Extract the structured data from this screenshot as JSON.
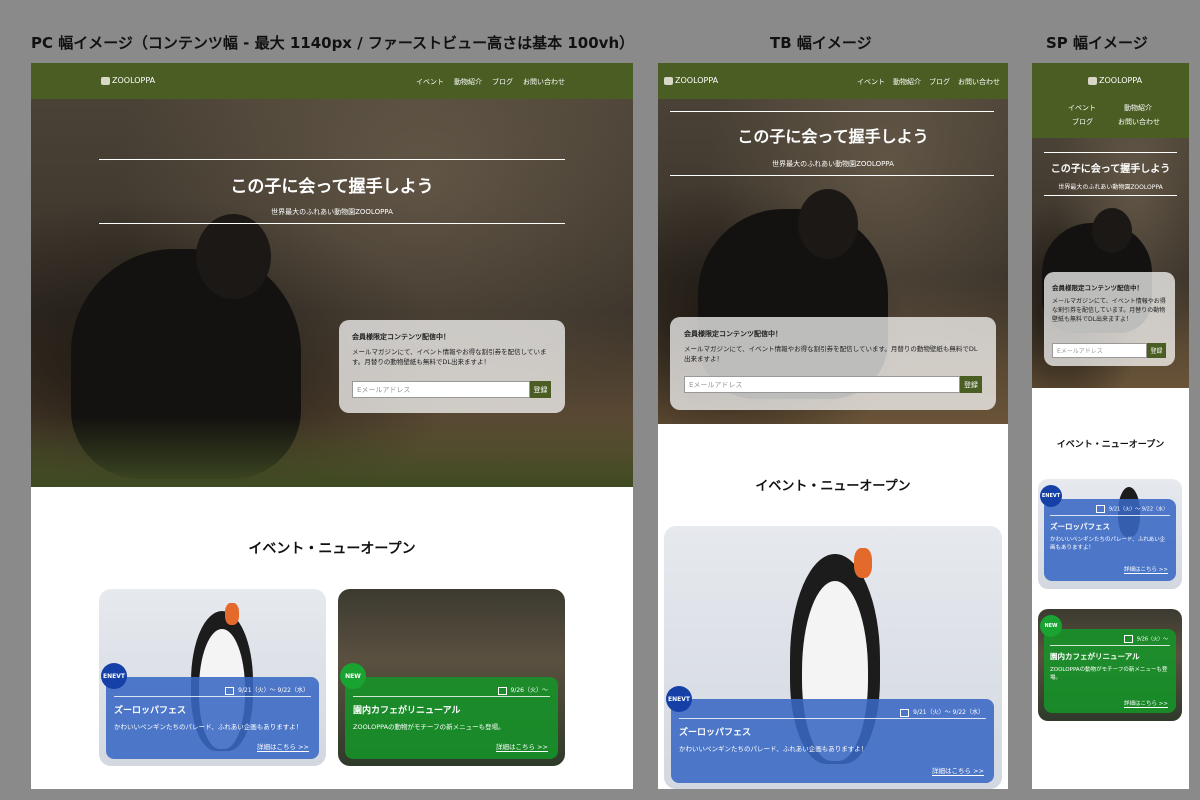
{
  "labels": {
    "pc": "PC 幅イメージ（コンテンツ幅 - 最大 1140px / ファーストビュー高さは基本 100vh）",
    "tb": "TB 幅イメージ",
    "sp": "SP 幅イメージ"
  },
  "brand": "ZOOLOPPA",
  "nav": [
    "イベント",
    "動物紹介",
    "ブログ",
    "お問い合わせ"
  ],
  "hero": {
    "title": "この子に会って握手しよう",
    "subtitle": "世界最大のふれあい動物園ZOOLOPPA"
  },
  "member": {
    "title": "会員様限定コンテンツ配信中！",
    "body": "メールマガジンにて、イベント情報やお得な割引券を配信しています。月替りの動物壁紙も無料でDL出来ますよ！",
    "placeholder": "Eメールアドレス",
    "button": "登録"
  },
  "section_title": "イベント・ニューオープン",
  "events": [
    {
      "badge": "ENEVT",
      "title": "ズーロッパフェス",
      "body": "かわいいペンギンたちのパレード、ふれあい企画もありますよ！",
      "date": "9/21（火）～ 9/22（水）",
      "more": "詳細はこちら >>"
    },
    {
      "badge": "NEW",
      "title": "園内カフェがリニューアル",
      "body": "ZOOLOPPAの動物がモチーフの新メニューも登場。",
      "date": "9/26（火）～",
      "more": "詳細はこちら >>"
    }
  ],
  "colors": {
    "header": "#4a5d23",
    "event_blue": "#3968c4",
    "event_green": "#149628",
    "badge_blue": "#1440a8",
    "badge_green": "#19a331"
  },
  "icons": [
    "calendar-icon",
    "zoo-logo-icon"
  ]
}
